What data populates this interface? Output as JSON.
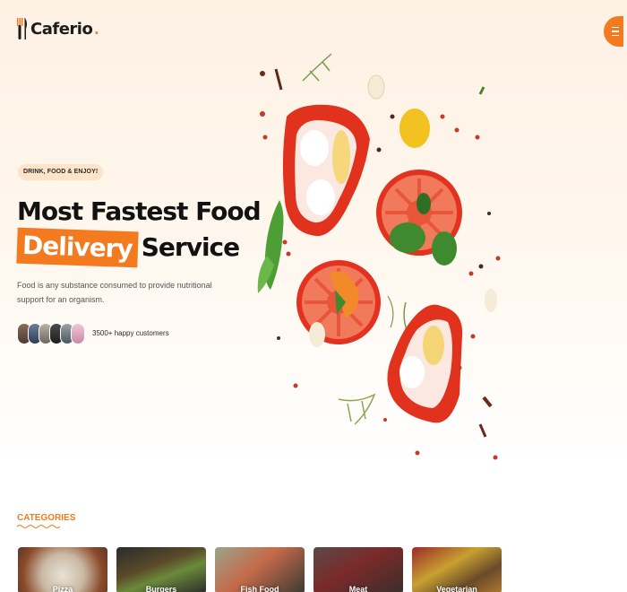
{
  "header": {
    "brand": "Caferio",
    "brand_dot": ".",
    "logo_icon": "fork-knife-icon",
    "menu_icon": "hamburger-menu-icon"
  },
  "hero": {
    "badge": "DRINK, FOOD & ENJOY!",
    "headline_line1": "Most Fastest Food",
    "headline_highlight": "Delivery",
    "headline_rest": "Service",
    "description": "Food is any substance consumed to provide nutritional support for an organism.",
    "customers_text": "3500+ happy customers",
    "avatar_count": 6
  },
  "categories": {
    "title": "CATEGORIES",
    "items": [
      {
        "label": "Pizza"
      },
      {
        "label": "Burgers"
      },
      {
        "label": "Fish Food"
      },
      {
        "label": "Meat"
      },
      {
        "label": "Vegetarian"
      }
    ]
  },
  "colors": {
    "accent": "#f47a1f",
    "text_dark": "#121212",
    "hero_bg": "#fdf1e4"
  }
}
